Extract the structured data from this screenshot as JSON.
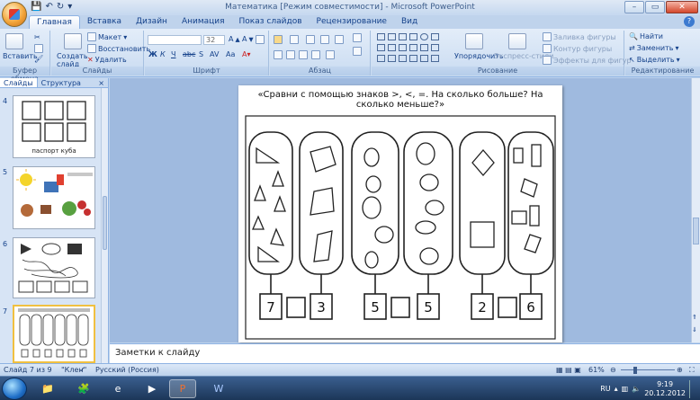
{
  "window": {
    "title": "Математика [Режим совместимости] - Microsoft PowerPoint"
  },
  "tabs": [
    "Главная",
    "Вставка",
    "Дизайн",
    "Анимация",
    "Показ слайдов",
    "Рецензирование",
    "Вид"
  ],
  "ribbon": {
    "clipboard": {
      "label": "Буфер обмена",
      "paste": "Вставить"
    },
    "slides": {
      "label": "Слайды",
      "new_slide": "Создать слайд",
      "layout": "Макет",
      "reset": "Восстановить",
      "delete": "Удалить"
    },
    "font": {
      "label": "Шрифт",
      "size": "32"
    },
    "paragraph": {
      "label": "Абзац"
    },
    "drawing": {
      "label": "Рисование",
      "arrange": "Упорядочить",
      "quick_styles": "Экспресс-стили",
      "shape_fill": "Заливка фигуры",
      "shape_outline": "Контур фигуры",
      "shape_effects": "Эффекты для фигур"
    },
    "editing": {
      "label": "Редактирование",
      "find": "Найти",
      "replace": "Заменить",
      "select": "Выделить"
    }
  },
  "left_panel": {
    "tabs": [
      "Слайды",
      "Структура"
    ],
    "close": "×",
    "slides": [
      {
        "number": "4",
        "caption": "паспорт куба"
      },
      {
        "number": "5",
        "caption": ""
      },
      {
        "number": "6",
        "caption": ""
      },
      {
        "number": "7",
        "caption": ""
      }
    ]
  },
  "slide": {
    "title": "«Сравни с помощью знаков >, <, =. На сколько больше? На сколько меньше?»",
    "numbers": [
      "7",
      "3",
      "5",
      "5",
      "2",
      "6"
    ]
  },
  "notes": {
    "placeholder": "Заметки к слайду"
  },
  "status": {
    "slide": "Слайд 7 из 9",
    "theme": "\"Клен\"",
    "language": "Русский (Россия)",
    "zoom": "61%"
  },
  "taskbar": {
    "lang": "RU",
    "time": "9:19",
    "date": "20.12.2012"
  }
}
